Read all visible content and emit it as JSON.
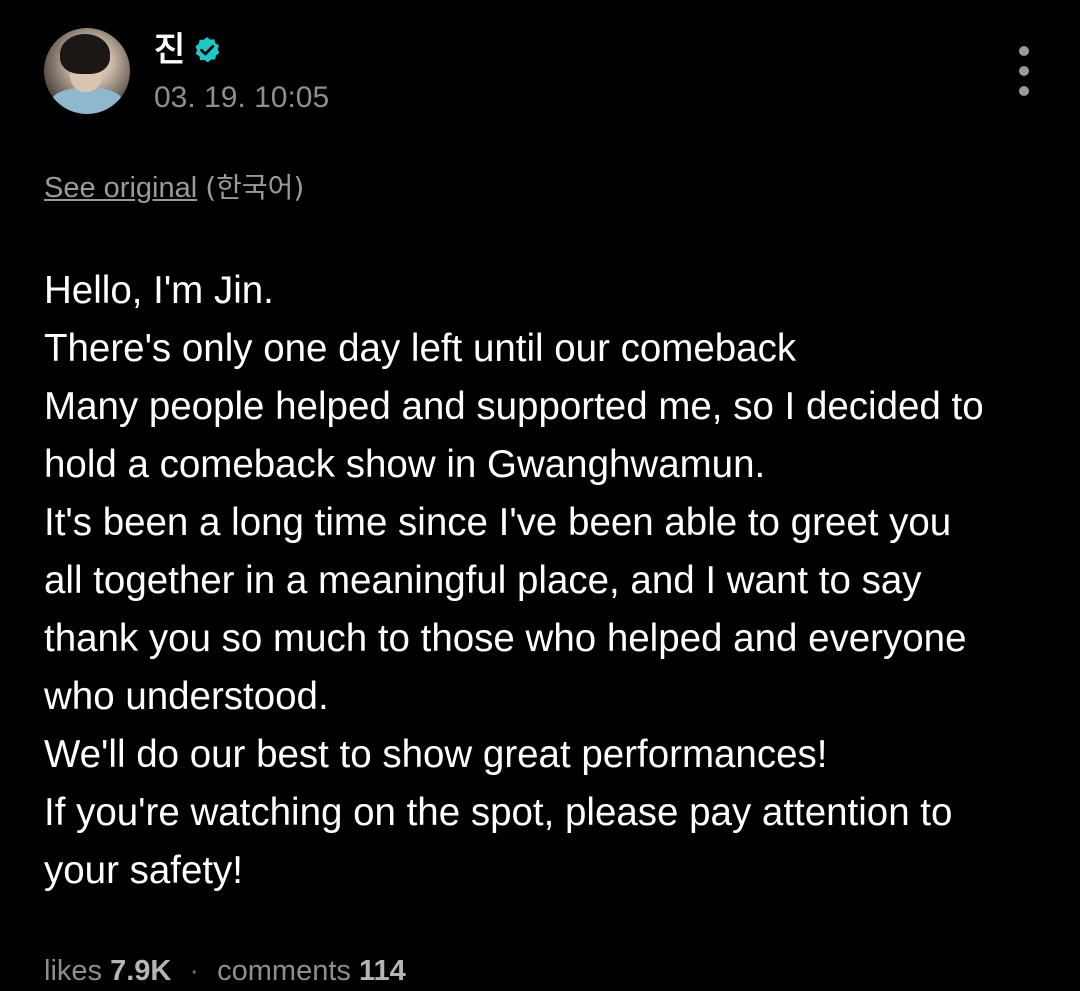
{
  "post": {
    "author": {
      "name": "진",
      "verified": true
    },
    "timestamp": "03. 19. 10:05",
    "translation": {
      "link_label": "See original",
      "language": "(한국어)"
    },
    "body_lines": [
      "Hello, I'm Jin.",
      "There's only one day left until our comeback",
      "Many people helped and supported me, so I decided to",
      "hold a comeback show in Gwanghwamun.",
      "It's been a long time since I've been able to greet you",
      "all together in a meaningful place, and I want to say",
      "thank you so much to those who helped and everyone",
      "who understood.",
      "We'll do our best to show great performances!",
      "If you're watching on the spot, please pay attention to",
      "your safety!"
    ],
    "stats": {
      "likes_label": "likes",
      "likes_count": "7.9K",
      "separator": "·",
      "comments_label": "comments",
      "comments_count": "114"
    }
  },
  "icons": {
    "verified": "verified-badge-icon",
    "more": "more-vertical-icon"
  },
  "colors": {
    "background": "#000000",
    "text_primary": "#ffffff",
    "text_secondary": "#8e8e8e",
    "verified_badge": "#1ec8c8"
  }
}
